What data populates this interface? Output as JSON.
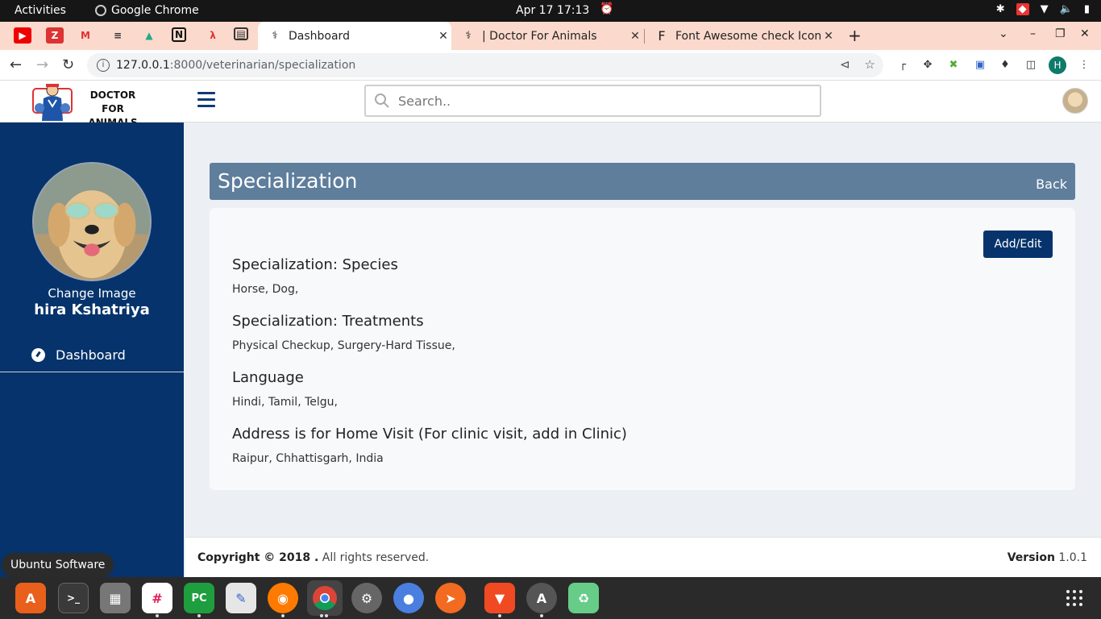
{
  "os": {
    "activities": "Activities",
    "app_name": "Google Chrome",
    "clock": "Apr 17  17:13"
  },
  "browser": {
    "tabs": [
      {
        "title": "Dashboard",
        "active": true
      },
      {
        "title": "| Doctor For Animals",
        "active": false
      },
      {
        "title": "Font Awesome check Icon",
        "active": false
      }
    ],
    "url_host": "127.0.0.1",
    "url_path": ":8000/veterinarian/specialization",
    "profile_initial": "H"
  },
  "header": {
    "brand_line1": "DOCTOR FOR",
    "brand_line2": "ANIMALS",
    "search_placeholder": "Search.."
  },
  "sidebar": {
    "change_image": "Change Image",
    "username": "hira Kshatriya",
    "nav": [
      {
        "label": "Dashboard",
        "icon": "tachometer-icon"
      }
    ]
  },
  "main": {
    "title": "Specialization",
    "back_label": "Back",
    "add_edit_label": "Add/Edit",
    "sections": [
      {
        "heading": "Specialization: Species",
        "value": "Horse, Dog,"
      },
      {
        "heading": "Specialization: Treatments",
        "value": "Physical Checkup, Surgery-Hard Tissue,"
      },
      {
        "heading": "Language",
        "value": "Hindi, Tamil, Telgu,"
      },
      {
        "heading": "Address is for Home Visit (For clinic visit, add in Clinic)",
        "value": "Raipur, Chhattisgarh, India"
      }
    ]
  },
  "footer": {
    "copyright_bold": "Copyright © 2018 .",
    "copyright_rest": " All rights reserved.",
    "version_label": "Version",
    "version_value": " 1.0.1"
  },
  "dock": {
    "tooltip": "Ubuntu Software"
  },
  "colors": {
    "sidebar": "#06336b",
    "panel_header": "#5e7e9c",
    "page_bg": "#ecf0f4",
    "tabbar": "#fbd9cc"
  }
}
